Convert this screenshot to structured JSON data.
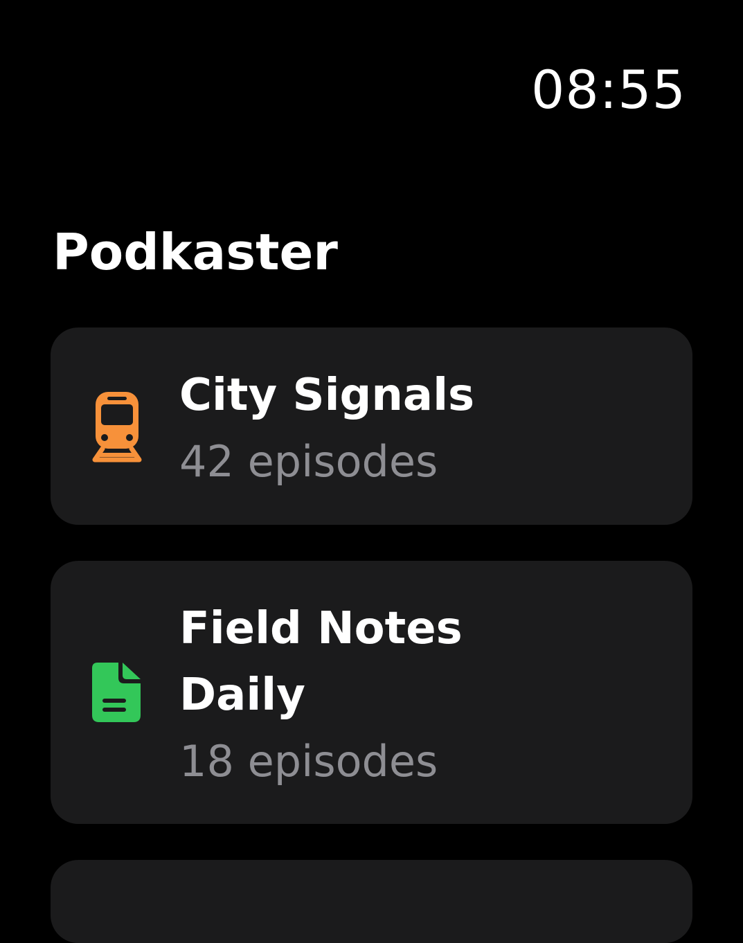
{
  "status": {
    "time": "08:55"
  },
  "header": {
    "title": "Podkaster"
  },
  "podcasts": [
    {
      "title": "City Signals",
      "episodes": "42 episodes",
      "icon": "train-icon",
      "color": "#f7913a"
    },
    {
      "title": "Field Notes Daily",
      "episodes": "18 episodes",
      "icon": "document-icon",
      "color": "#33c759"
    }
  ]
}
